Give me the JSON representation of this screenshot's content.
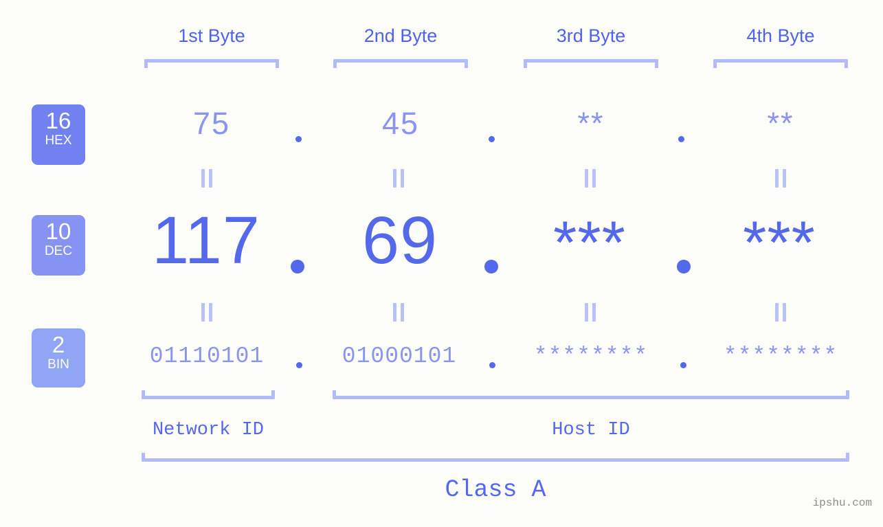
{
  "meta": {
    "background_color": "#fcfdf8",
    "accent_color": "#5368ea",
    "muted_accent_color": "#8b95ee",
    "bracket_color": "#b2bbf7",
    "watermark": "ipshu.com"
  },
  "headers": [
    {
      "label": "1st Byte"
    },
    {
      "label": "2nd Byte"
    },
    {
      "label": "3rd Byte"
    },
    {
      "label": "4th Byte"
    }
  ],
  "bases": [
    {
      "number": "16",
      "name": "HEX",
      "color": "#7182f0"
    },
    {
      "number": "10",
      "name": "DEC",
      "color": "#8793f2"
    },
    {
      "number": "2",
      "name": "BIN",
      "color": "#90a6f5"
    }
  ],
  "rows": {
    "hex": {
      "values": [
        "75",
        "45",
        "**",
        "**"
      ],
      "separators": [
        ".",
        ".",
        "."
      ]
    },
    "dec": {
      "values": [
        "117",
        "69",
        "***",
        "***"
      ],
      "separators": [
        ".",
        ".",
        "."
      ]
    },
    "bin": {
      "values": [
        "01110101",
        "01000101",
        "********",
        "********"
      ],
      "separators": [
        ".",
        ".",
        "."
      ]
    }
  },
  "equals_symbol": "=",
  "segments": {
    "network_id": "Network ID",
    "host_id": "Host ID",
    "class": "Class A"
  },
  "ip": {
    "dotted_decimal": "117.69.***.***",
    "dotted_hex": "75.45.**.**",
    "dotted_binary": "01110101.01000101.********.********",
    "class": "A"
  }
}
